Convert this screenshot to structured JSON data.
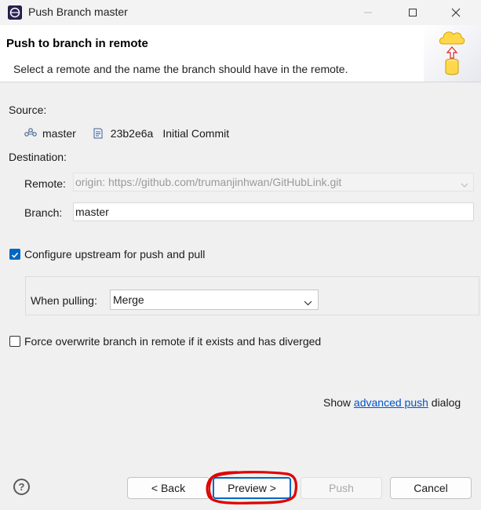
{
  "window": {
    "title": "Push Branch master"
  },
  "header": {
    "title": "Push to branch in remote",
    "description": "Select a remote and the name the branch should have in the remote."
  },
  "source": {
    "label": "Source:",
    "branch": "master",
    "commit_id": "23b2e6a",
    "commit_message": "Initial Commit"
  },
  "destination": {
    "label": "Destination:",
    "remote_label": "Remote:",
    "remote_value": "origin: https://github.com/trumanjinhwan/GitHubLink.git",
    "branch_label": "Branch:",
    "branch_value": "master"
  },
  "options": {
    "configure_upstream_label": "Configure upstream for push and pull",
    "configure_upstream_checked": true,
    "when_pulling_label": "When pulling:",
    "when_pulling_value": "Merge",
    "force_overwrite_label": "Force overwrite branch in remote if it exists and has diverged",
    "force_overwrite_checked": false
  },
  "advanced": {
    "prefix": "Show",
    "link": "advanced push",
    "suffix": "dialog"
  },
  "footer": {
    "help_glyph": "?",
    "back_label": "< Back",
    "preview_label": "Preview >",
    "push_label": "Push",
    "cancel_label": "Cancel"
  },
  "colors": {
    "accent": "#0067c0",
    "link": "#0055cc",
    "annotation": "#e00000"
  }
}
